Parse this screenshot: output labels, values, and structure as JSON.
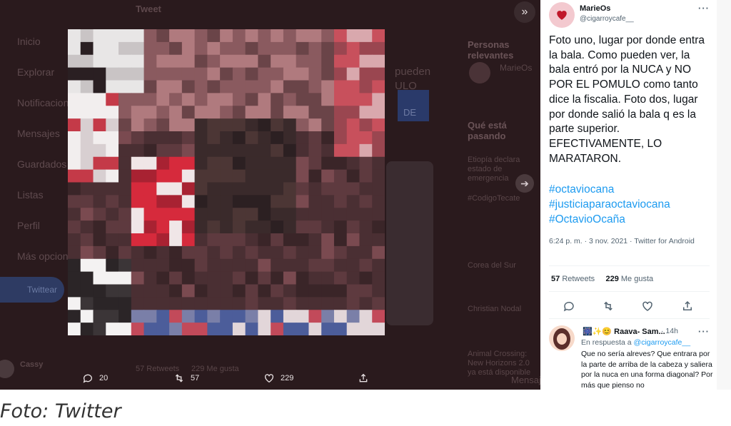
{
  "background": {
    "header_title": "Tweet",
    "nav": [
      "Inicio",
      "Explorar",
      "Notificaciones",
      "Mensajes",
      "Guardados",
      "Listas",
      "Perfil",
      "Más opciones"
    ],
    "tweet_button": "Twittear",
    "right_col_heading_1": "Personas relevantes",
    "right_col_heading_2": "Qué está pasando",
    "related_name": "MarieOs",
    "trend_1": "Etiopía declara estado de emergencia",
    "trend_2": "#CodigoTecate",
    "trend_3": "Corea del Sur",
    "trend_4": "Christian Nodal",
    "trend_5": "Animal Crossing: New Horizons 2.0 ya está disponible",
    "profile_name": "Cassy",
    "bg_text_1": "pueden",
    "bg_text_2": "ULO",
    "bg_text_3": "DE",
    "retweets_label": "57 Retweets",
    "likes_label": "229 Me gusta",
    "messages_label": "Mensajes"
  },
  "media_actions": {
    "replies": "20",
    "retweets": "57",
    "likes": "229"
  },
  "tweet": {
    "author_name": "MarieOs",
    "author_handle": "@cigarroycafe__",
    "text": "Foto uno, lugar por donde entra la bala. Como pueden ver, la bala entró por la NUCA y NO POR EL POMULO como tanto dice la fiscalia. Foto dos, lugar por donde salió la bala q es la parte superior. EFECTIVAMENTE, LO MARATARON.",
    "hashtags": [
      "#octaviocana",
      "#justiciaparaoctaviocana",
      "#OctavioOcaña"
    ],
    "timestamp": "6:24 p. m. · 3 nov. 2021 · Twitter for Android",
    "retweets_count": "57",
    "retweets_label": "Retweets",
    "likes_count": "229",
    "likes_label": "Me gusta"
  },
  "reply": {
    "name": "Raava- Sam...",
    "time": "· 14h",
    "in_reply_prefix": "En respuesta a ",
    "in_reply_handle": "@cigarroycafe__",
    "text": "Que no sería alreves? Que entrara por la parte de arriba de la cabeza y saliera por la nuca en una forma diagonal? Por más que pienso no"
  },
  "caption": "Foto: Twitter",
  "colors": {
    "accent": "#1d9bf0",
    "overlay": "#2a1a1d",
    "avatar_bg": "#f3c9cf",
    "heart_red": "#c0182a"
  },
  "icons": [
    "expand-icon",
    "reply-icon",
    "retweet-icon",
    "like-icon",
    "share-icon",
    "more-icon",
    "arrow-right-icon"
  ]
}
